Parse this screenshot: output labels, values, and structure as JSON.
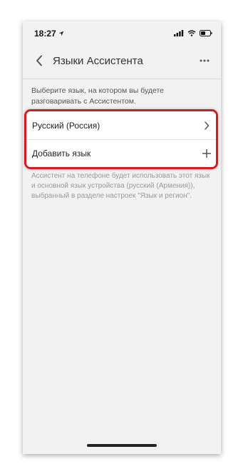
{
  "status_bar": {
    "time": "18:27",
    "icons": [
      "location-arrow-icon",
      "signal-icon",
      "wifi-icon",
      "battery-icon"
    ]
  },
  "header": {
    "title": "Языки Ассистента",
    "back_icon": "chevron-left-icon",
    "menu_icon": "more-horizontal-icon"
  },
  "intro": "Выберите язык, на котором вы будете разговаривать с Ассистентом.",
  "languages": {
    "items": [
      {
        "label": "Русский (Россия)",
        "icon": "chevron-right-icon"
      },
      {
        "label": "Добавить язык",
        "icon": "plus-icon"
      }
    ]
  },
  "footer_note": "Ассистент на телефоне будет использовать этот язык и основной язык устройства (русский (Армения)), выбранный в разделе настроек \"Язык и регион\".",
  "colors": {
    "highlight": "#d31c1c",
    "background": "#f2f2f2",
    "card": "#ffffff"
  }
}
